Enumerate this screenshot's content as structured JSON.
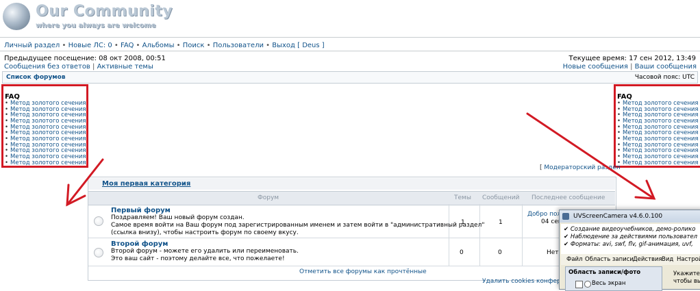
{
  "header": {
    "site_title": "Our Community",
    "tagline": "where you always are welcome"
  },
  "nav": {
    "items": [
      "Личный раздел",
      "Новые ЛС: 0",
      "FAQ",
      "Альбомы",
      "Поиск",
      "Пользователи",
      "Выход [ Deus ]"
    ]
  },
  "info": {
    "last_visit": "Предыдущее посещение: 08 окт 2008, 00:51",
    "current_time": "Текущее время: 17 сен 2012, 13:49",
    "left_links": [
      "Сообщения без ответов",
      "Активные темы"
    ],
    "right_links": [
      "Новые сообщения",
      "Ваши сообщения"
    ],
    "forum_list": "Список форумов",
    "timezone": "Часовой пояс: UTC"
  },
  "faq_box": {
    "title": "FAQ",
    "items": [
      "Метод золотого сечения",
      "Метод золотого сечения",
      "Метод золотого сечения",
      "Метод золотого сечения",
      "Метод золотого сечения",
      "Метод золотого сечения",
      "Метод золотого сечения",
      "Метод золотого сечения",
      "Метод золотого сечения",
      "Метод золотого сечения",
      "Метод золотого сечения"
    ]
  },
  "moderator_link": "Модераторский раздел",
  "forum_table": {
    "category": "Моя первая категория",
    "headers": {
      "forum": "Форум",
      "topics": "Темы",
      "posts": "Сообщений",
      "last_post": "Последнее сообщение"
    },
    "forums": [
      {
        "title": "Первый форум",
        "desc": [
          "Поздравляем! Ваш новый форум создан.",
          "Самое время войти на Ваш форум под зарегистрированным именем и затем войти в \"административный раздел\"",
          "(ссылка внизу), чтобы настроить форум по своему вкусу."
        ],
        "topics": "1",
        "posts": "1",
        "last_post": [
          "Добро пож",
          "04 сен"
        ]
      },
      {
        "title": "Второй форум",
        "desc": [
          "Второй форум - можете его удалить или переименовать.",
          "Это ваш сайт - поэтому делайте все, что пожелаете!"
        ],
        "topics": "0",
        "posts": "0",
        "last_post": [
          "Нет"
        ]
      }
    ],
    "mark_read": "Отметить все форумы как прочтённые"
  },
  "footer_link": "Удалить cookies конфере",
  "uv_window": {
    "title": "UVScreenCamera v4.6.0.100",
    "features": [
      "Создание видеоучебников, демо-ролико",
      "Наблюдение за действиями пользовател",
      "Форматы: avi, swf, flv, gif-анимация, uvf,"
    ],
    "menu": [
      "Файл",
      "Область записи",
      "Действия",
      "Вид",
      "Настройк"
    ],
    "panel_title": "Область записи/фото",
    "option": "Весь экран",
    "side_text": [
      "Укажите п",
      "чтобы вы"
    ]
  },
  "colors": {
    "annotation_red": "#d21a24",
    "link": "#105289"
  }
}
